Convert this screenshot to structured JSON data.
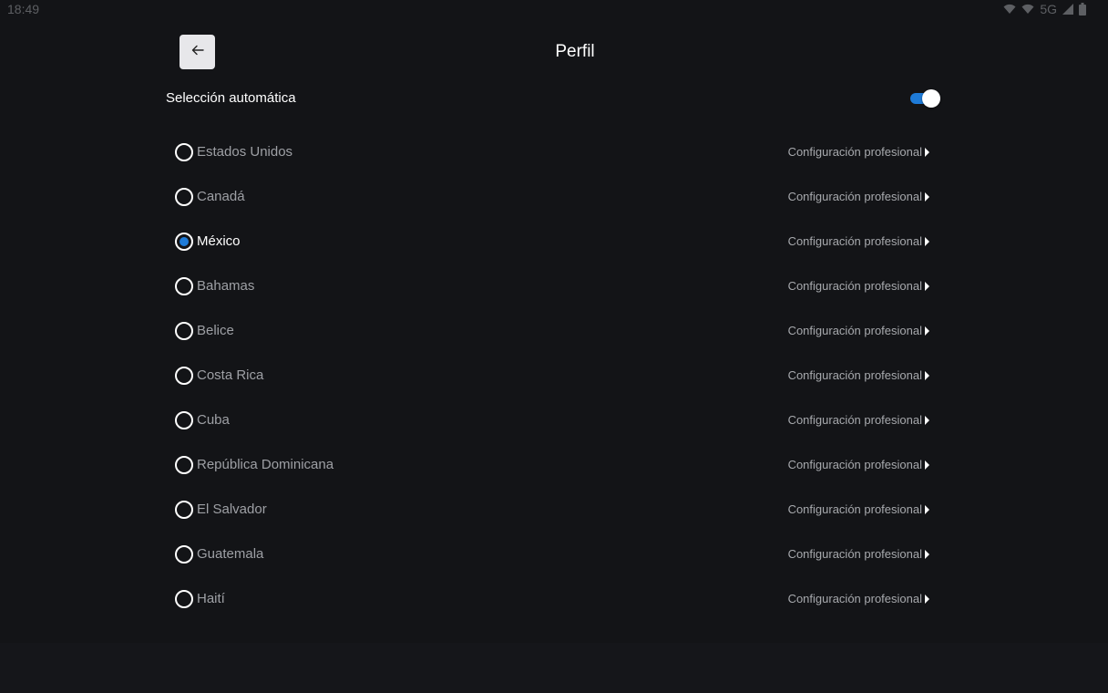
{
  "status_bar": {
    "time": "18:49",
    "network": "5G",
    "icons": [
      "wifi-icon",
      "wifi-icon",
      "signal-icon",
      "battery-icon"
    ]
  },
  "header": {
    "back_icon": "arrow-left-icon",
    "title": "Perfil"
  },
  "auto_selection": {
    "label": "Selección automática",
    "enabled": true
  },
  "countries": [
    {
      "name": "Estados Unidos",
      "link": "Configuración profesional",
      "selected": false
    },
    {
      "name": "Canadá",
      "link": "Configuración profesional",
      "selected": false
    },
    {
      "name": "México",
      "link": "Configuración profesional",
      "selected": true
    },
    {
      "name": "Bahamas",
      "link": "Configuración profesional",
      "selected": false
    },
    {
      "name": "Belice",
      "link": "Configuración profesional",
      "selected": false
    },
    {
      "name": "Costa Rica",
      "link": "Configuración profesional",
      "selected": false
    },
    {
      "name": "Cuba",
      "link": "Configuración profesional",
      "selected": false
    },
    {
      "name": "República Dominicana",
      "link": "Configuración profesional",
      "selected": false
    },
    {
      "name": "El Salvador",
      "link": "Configuración profesional",
      "selected": false
    },
    {
      "name": "Guatemala",
      "link": "Configuración profesional",
      "selected": false
    },
    {
      "name": "Haití",
      "link": "Configuración profesional",
      "selected": false
    }
  ],
  "colors": {
    "background": "#131417",
    "accent": "#1e7bd8",
    "text_primary": "#ffffff",
    "text_secondary": "#9ea0a5"
  }
}
